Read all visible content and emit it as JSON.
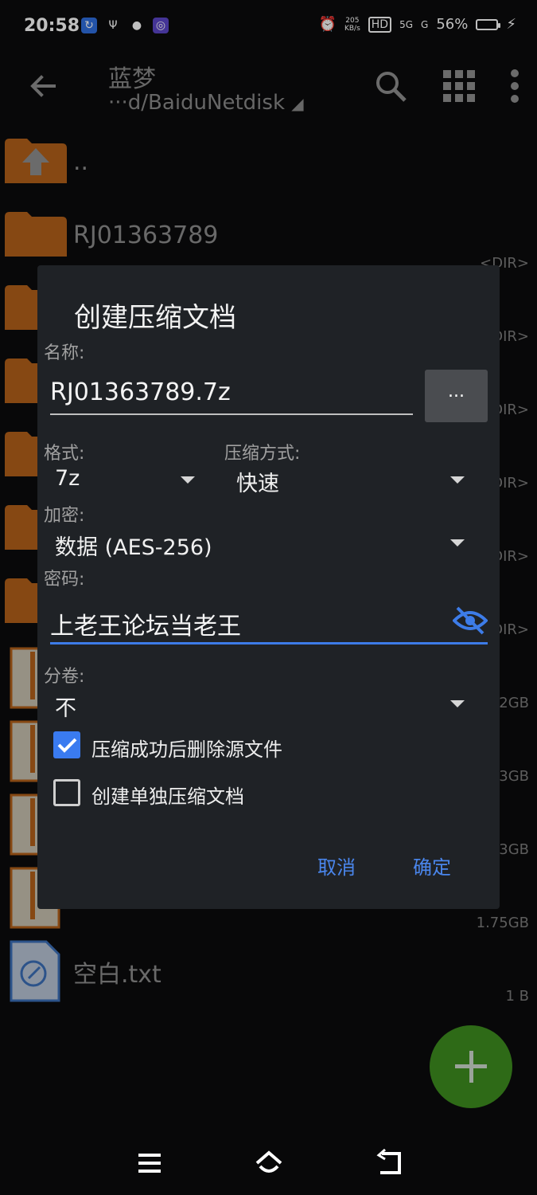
{
  "status_bar": {
    "time": "20:58",
    "net_speed_value": "205",
    "net_speed_unit": "KB/s",
    "hd": "HD",
    "signal1": "5G",
    "signal2": "G",
    "battery": "56%",
    "battery_level": 0.56
  },
  "toolbar": {
    "title": "蓝梦",
    "path": "···d/BaiduNetdisk"
  },
  "files": [
    {
      "name": "..",
      "meta": ""
    },
    {
      "name": "RJ01363789",
      "meta": "<DIR>"
    },
    {
      "name": "",
      "meta": "<DIR>"
    },
    {
      "name": "",
      "meta": "<DIR>"
    },
    {
      "name": "",
      "meta": "<DIR>"
    },
    {
      "name": "",
      "meta": "<DIR>"
    },
    {
      "name": "",
      "meta": "<DIR>"
    },
    {
      "name": "",
      "meta": "2GB"
    },
    {
      "name": "",
      "meta": "3GB"
    },
    {
      "name": "",
      "meta": "3GB"
    },
    {
      "name": "",
      "meta": "1.75GB"
    },
    {
      "name": "空白.txt",
      "meta": "1 B"
    }
  ],
  "dialog": {
    "title": "创建压缩文档",
    "name_label": "名称:",
    "name_value": "RJ01363789.7z",
    "browse_label": "...",
    "format_label": "格式:",
    "format_value": "7z",
    "method_label": "压缩方式:",
    "method_value": "快速",
    "encrypt_label": "加密:",
    "encrypt_value": "数据 (AES-256)",
    "password_label": "密码:",
    "password_value": "上老王论坛当老王",
    "split_label": "分卷:",
    "split_value": "不",
    "delete_source_label": "压缩成功后删除源文件",
    "delete_source_checked": true,
    "separate_archive_label": "创建单独压缩文档",
    "separate_archive_checked": false,
    "cancel_label": "取消",
    "ok_label": "确定"
  },
  "colors": {
    "accent": "#3d7ce8",
    "folder": "#c96b1a",
    "fab": "#2e6a17"
  }
}
